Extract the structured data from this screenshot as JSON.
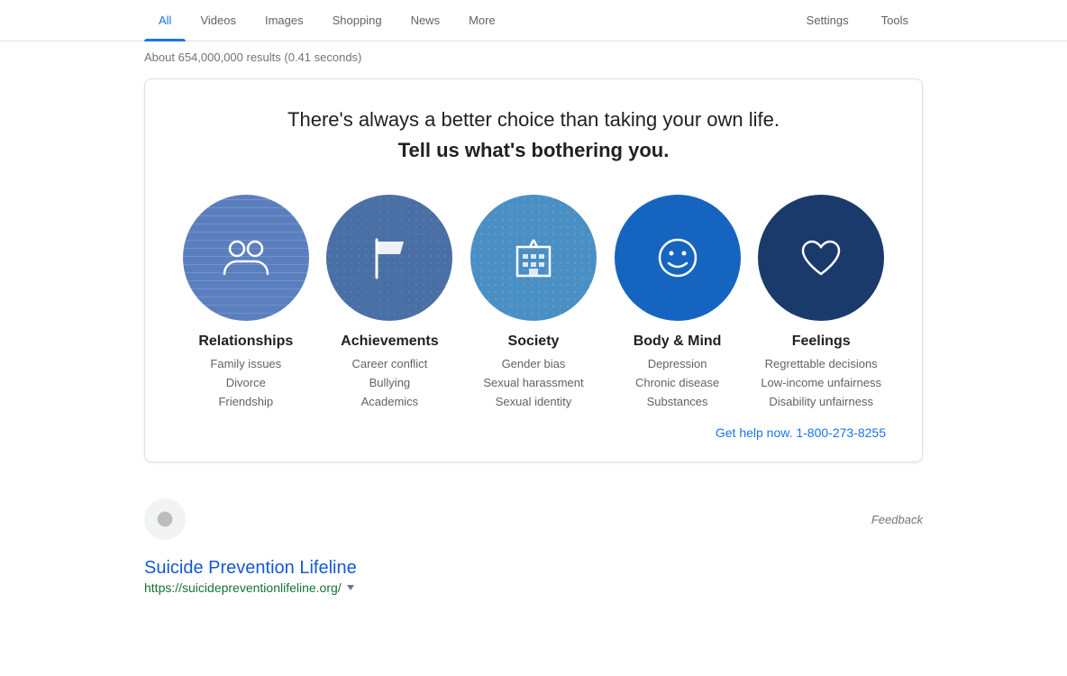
{
  "nav": {
    "tabs": [
      {
        "label": "All",
        "active": true
      },
      {
        "label": "Videos",
        "active": false
      },
      {
        "label": "Images",
        "active": false
      },
      {
        "label": "Shopping",
        "active": false
      },
      {
        "label": "News",
        "active": false
      },
      {
        "label": "More",
        "active": false
      }
    ],
    "right_tabs": [
      {
        "label": "Settings"
      },
      {
        "label": "Tools"
      }
    ]
  },
  "results_info": "About 654,000,000 results (0.41 seconds)",
  "crisis_card": {
    "headline": "There's always a better choice than taking your own life.",
    "subheadline": "Tell us what's bothering you.",
    "categories": [
      {
        "id": "relationships",
        "title": "Relationships",
        "subtitles": [
          "Family issues",
          "Divorce",
          "Friendship"
        ],
        "icon": "people"
      },
      {
        "id": "achievements",
        "title": "Achievements",
        "subtitles": [
          "Career conflict",
          "Bullying",
          "Academics"
        ],
        "icon": "flag"
      },
      {
        "id": "society",
        "title": "Society",
        "subtitles": [
          "Gender bias",
          "Sexual harassment",
          "Sexual identity"
        ],
        "icon": "building"
      },
      {
        "id": "body-mind",
        "title": "Body & Mind",
        "subtitles": [
          "Depression",
          "Chronic disease",
          "Substances"
        ],
        "icon": "smiley"
      },
      {
        "id": "feelings",
        "title": "Feelings",
        "subtitles": [
          "Regrettable decisions",
          "Low-income unfairness",
          "Disability unfairness"
        ],
        "icon": "heart"
      }
    ],
    "help_link": "Get help now. 1-800-273-8255"
  },
  "feedback": "Feedback",
  "search_result": {
    "title": "Suicide Prevention Lifeline",
    "url": "https://suicidepreventionlifeline.org/"
  }
}
